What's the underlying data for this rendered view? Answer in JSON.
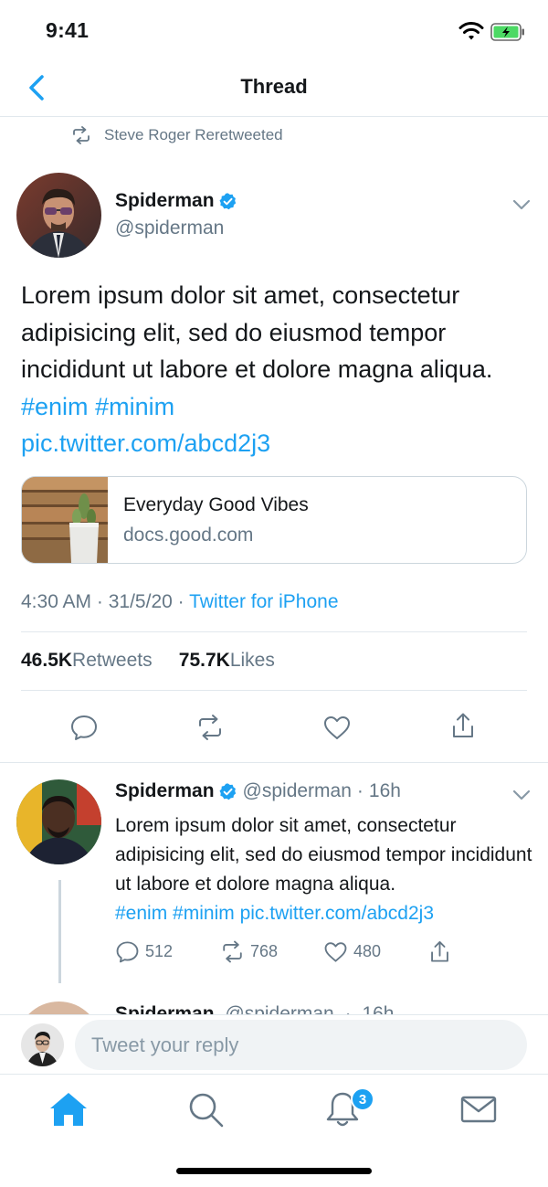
{
  "status_bar": {
    "time": "9:41"
  },
  "nav": {
    "title": "Thread"
  },
  "retweet_notice": "Steve Roger Reretweeted",
  "main_tweet": {
    "author_name": "Spiderman",
    "author_handle": "@spiderman",
    "text": "Lorem ipsum dolor sit amet, consectetur adipisicing elit, sed do eiusmod tempor incididunt ut labore et dolore magna aliqua.",
    "hashtag_1": "#enim",
    "hashtag_2": "#minim",
    "pic_link": "pic.twitter.com/abcd2j3",
    "card": {
      "title": "Everyday Good Vibes",
      "domain": "docs.good.com"
    },
    "time": "4:30 AM",
    "date": "31/5/20",
    "source": "Twitter for iPhone",
    "retweets_count": "46.5K",
    "retweets_label": "Retweets",
    "likes_count": "75.7K",
    "likes_label": "Likes"
  },
  "reply_tweet": {
    "author_name": "Spiderman",
    "author_handle": "@spiderman",
    "time_ago": "16h",
    "text": "Lorem ipsum dolor sit amet, consectetur adipisicing elit, sed do eiusmod tempor incididunt ut labore et dolore magna aliqua.",
    "hashtag_1": "#enim",
    "hashtag_2": "#minim",
    "pic_link": "pic.twitter.com/abcd2j3",
    "replies": "512",
    "retweets": "768",
    "likes": "480"
  },
  "peek_tweet": {
    "author_name": "Spiderman",
    "author_handle": "@spiderman",
    "time_ago": "16h"
  },
  "compose": {
    "placeholder": "Tweet your reply"
  },
  "tab_bar": {
    "notifications_badge": "3"
  },
  "colors": {
    "accent": "#1da1f2",
    "secondary_text": "#657786",
    "divider": "#e1e8ed"
  },
  "icons": [
    "back-chevron-icon",
    "retweet-icon",
    "verified-icon",
    "chevron-down-icon",
    "comment-icon",
    "heart-icon",
    "share-icon",
    "home-icon",
    "search-icon",
    "bell-icon",
    "mail-icon",
    "wifi-icon",
    "battery-icon"
  ]
}
